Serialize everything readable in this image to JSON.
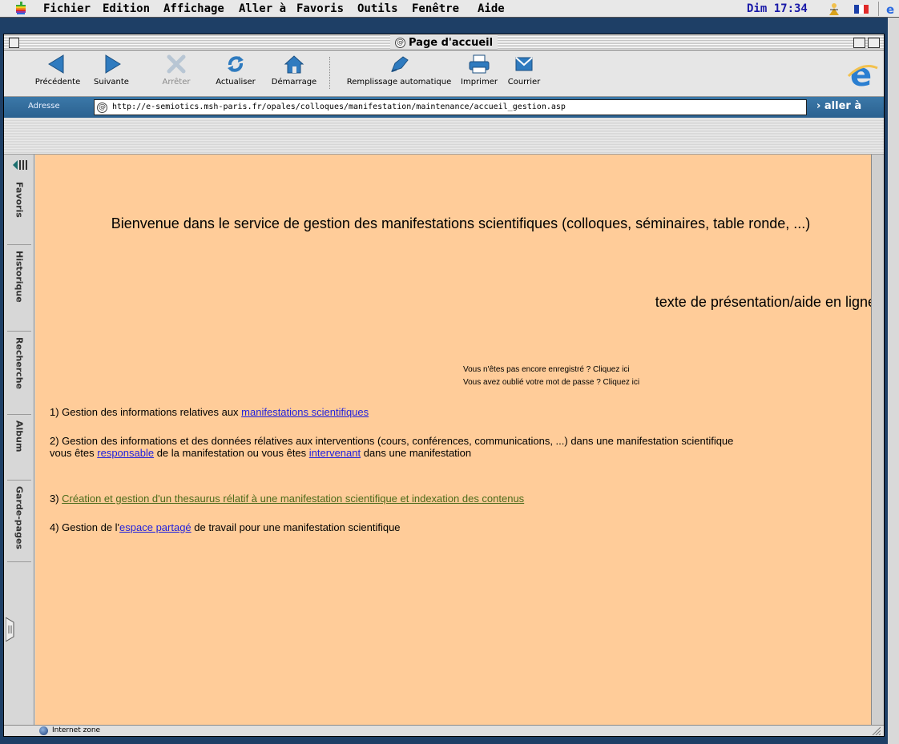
{
  "menubar": {
    "items": [
      "Fichier",
      "Edition",
      "Affichage",
      "Aller à",
      "Favoris",
      "Outils",
      "Fenêtre",
      "Aide"
    ],
    "clock": "Dim 17:34"
  },
  "window": {
    "title": "Page d'accueil"
  },
  "toolbar": {
    "back_label": "Précédente",
    "forward_label": "Suivante",
    "stop_label": "Arrêter",
    "refresh_label": "Actualiser",
    "home_label": "Démarrage",
    "autofill_label": "Remplissage automatique",
    "print_label": "Imprimer",
    "mail_label": "Courrier"
  },
  "address": {
    "label": "Adresse",
    "url": "http://e-semiotics.msh-paris.fr/opales/colloques/manifestation/maintenance/accueil_gestion.asp",
    "go_label": "aller à"
  },
  "sidebar": {
    "tabs": [
      "Favoris",
      "Historique",
      "Recherche",
      "Album",
      "Garde-pages"
    ]
  },
  "content": {
    "welcome": "Bienvenue dans le service de gestion des manifestations scientifiques (colloques, séminaires, table ronde, ...)",
    "help": "texte de présentation/aide en ligne",
    "not_registered": "Vous n'êtes pas encore enregistré ? Cliquez ici",
    "forgot_password": "Vous avez oublié votre mot de passe ? Cliquez ici",
    "item1_prefix": "1) Gestion des informations relatives aux ",
    "item1_link": "manifestations scientifiques ",
    "item2_text": "2) Gestion des informations et des données rélatives aux interventions (cours, conférences, communications, ...) dans une manifestation scientifique",
    "item2b_prefix": "vous êtes ",
    "item2b_link1": "responsable",
    "item2b_mid": " de la manifestation ou vous êtes ",
    "item2b_link2": "intervenant",
    "item2b_suffix": " dans une manifestation",
    "item3_prefix": "3) ",
    "item3_link": "Création et gestion d'un thesaurus rélatif à une manifestation scientifique et indexation des contenus",
    "item4_prefix": "4) Gestion de l'",
    "item4_link": "espace partagé",
    "item4_suffix": " de travail pour une manifestation scientifique"
  },
  "status": {
    "zone": "Internet zone"
  },
  "colors": {
    "content_bg": "#ffcc99",
    "link": "#1f1fdd",
    "visited_link": "#4a6a1a",
    "address_bar": "#2b6190"
  }
}
